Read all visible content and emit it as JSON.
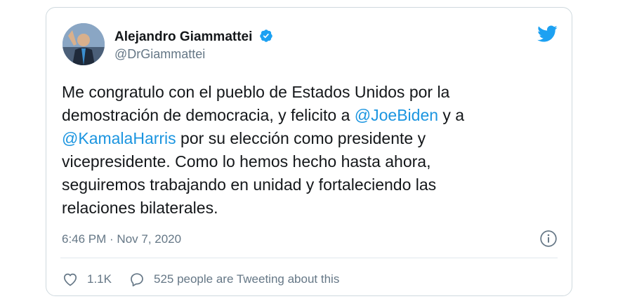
{
  "author": {
    "display_name": "Alejandro Giammattei",
    "handle": "@DrGiammattei"
  },
  "tweet": {
    "lines": [
      [
        {
          "text": "Me congratulo con el pueblo de Estados Unidos por la"
        }
      ],
      [
        {
          "text": "demostración de democracia, y felicito a "
        },
        {
          "text": "@JoeBiden",
          "mention": true
        },
        {
          "text": " y a"
        }
      ],
      [
        {
          "text": "@KamalaHarris",
          "mention": true
        },
        {
          "text": " por su elección como presidente y"
        }
      ],
      [
        {
          "text": "vicepresidente. Como lo hemos hecho hasta ahora,"
        }
      ],
      [
        {
          "text": "seguiremos trabajando en unidad y fortaleciendo las"
        }
      ],
      [
        {
          "text": "relaciones bilaterales."
        }
      ]
    ],
    "timestamp": "6:46 PM · Nov 7, 2020"
  },
  "actions": {
    "likes": "1.1K",
    "tweeting_text": "525 people are Tweeting about this"
  },
  "colors": {
    "twitter_blue": "#1da1f2",
    "mention": "#1b95e0",
    "text": "#14171a",
    "secondary": "#657786"
  },
  "icons": {
    "verified": "verified-badge-icon",
    "brand": "twitter-bird-icon",
    "info": "info-icon",
    "like": "heart-icon",
    "reply": "speech-bubble-icon"
  }
}
